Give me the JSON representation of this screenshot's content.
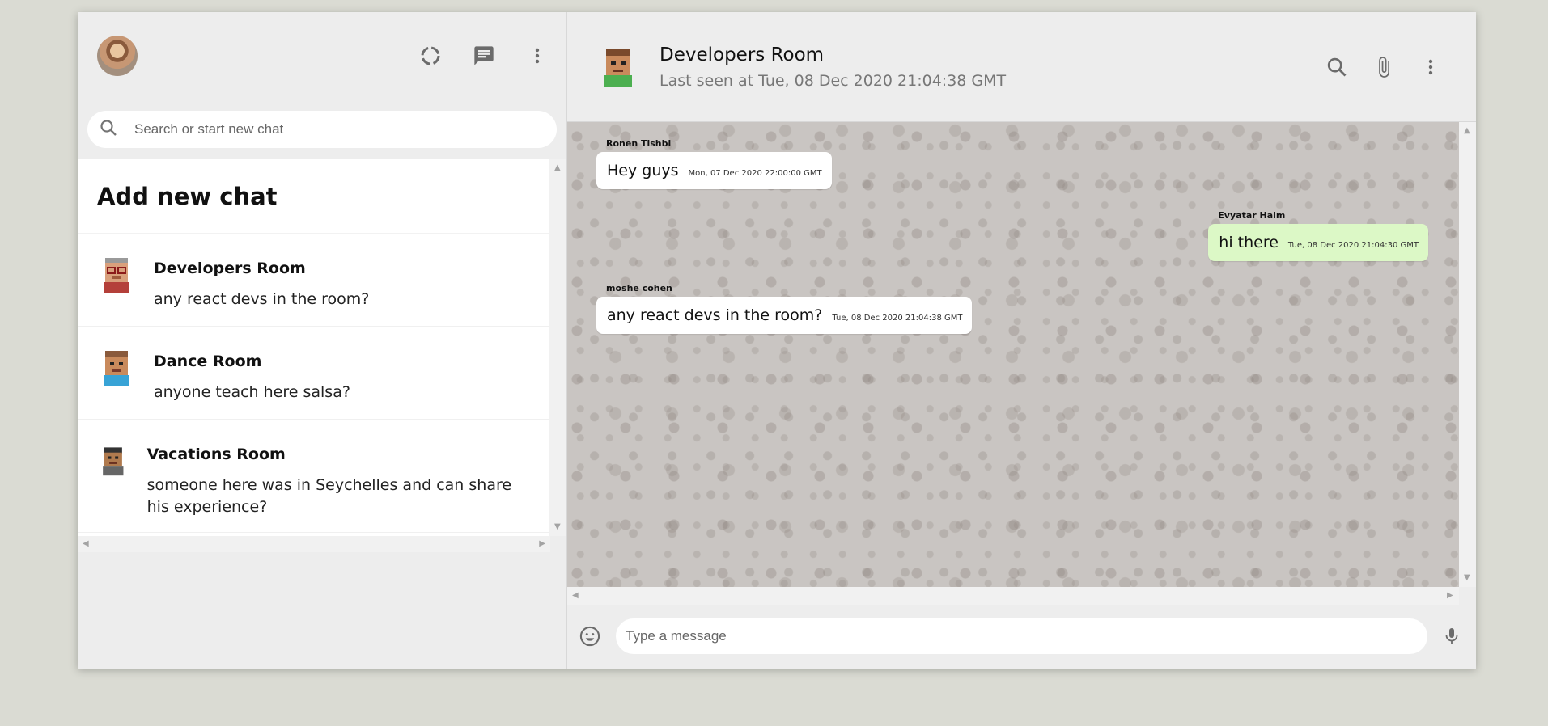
{
  "sidebar": {
    "search": {
      "placeholder": "Search or start new chat",
      "value": ""
    },
    "add_chat_label": "Add new chat",
    "chats": [
      {
        "name": "Developers Room",
        "last_message": "any react devs in the room?"
      },
      {
        "name": "Dance Room",
        "last_message": "anyone teach here salsa?"
      },
      {
        "name": "Vacations Room",
        "last_message": "someone here was in Seychelles and can share his experience?"
      }
    ]
  },
  "chat": {
    "room_name": "Developers Room",
    "last_seen": "Last seen at Tue, 08 Dec 2020 21:04:38 GMT",
    "messages": [
      {
        "sender": "Ronen Tishbi",
        "text": "Hey guys",
        "time": "Mon, 07 Dec 2020 22:00:00 GMT",
        "sent": false
      },
      {
        "sender": "Evyatar Haim",
        "text": "hi there",
        "time": "Tue, 08 Dec 2020 21:04:30 GMT",
        "sent": true
      },
      {
        "sender": "moshe cohen",
        "text": "any react devs in the room?",
        "time": "Tue, 08 Dec 2020 21:04:38 GMT",
        "sent": false
      }
    ],
    "composer": {
      "placeholder": "Type a message",
      "value": ""
    }
  },
  "icons": {
    "status": "status-icon",
    "new_chat": "chat-icon",
    "menu": "more-vert-icon",
    "search": "search-icon",
    "attach": "attach-icon",
    "emoji": "emoji-icon",
    "mic": "mic-icon"
  },
  "colors": {
    "app_bg": "#ededed",
    "page_bg": "#dadbd3",
    "sent_bubble": "#dcf8c6",
    "received_bubble": "#ffffff",
    "icon_gray": "#757575"
  }
}
